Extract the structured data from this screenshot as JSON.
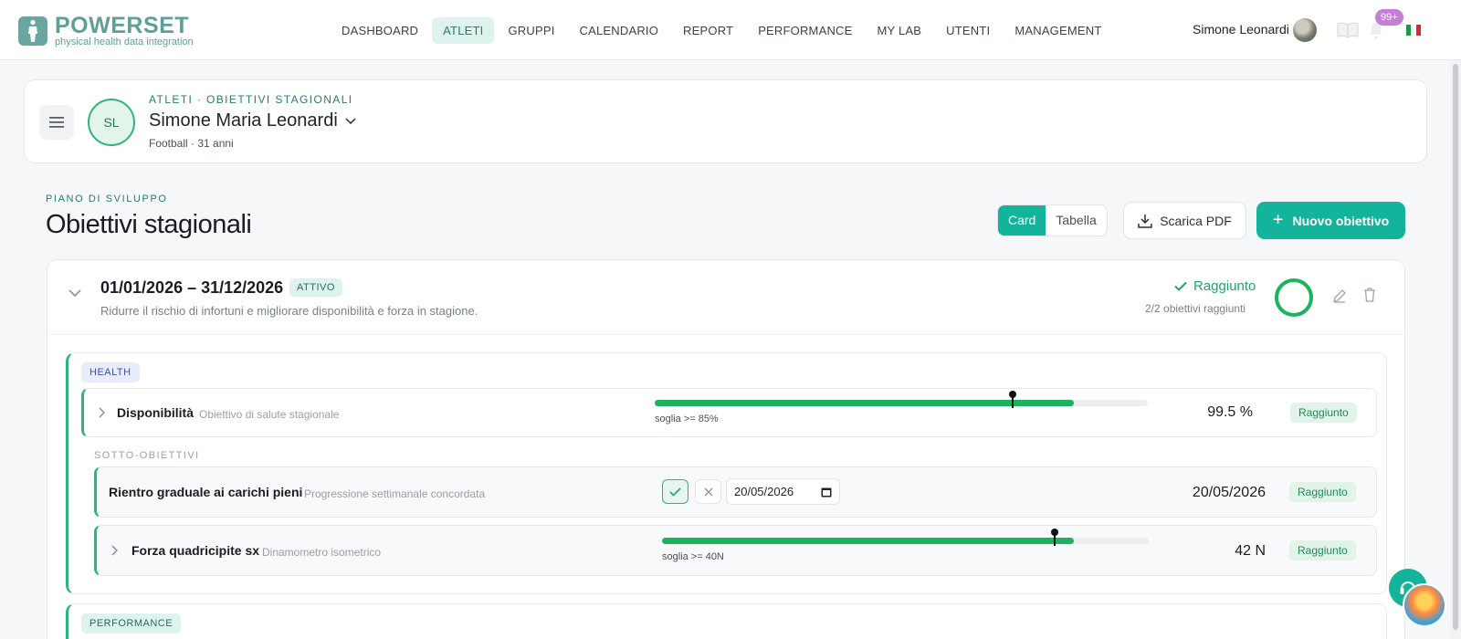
{
  "brand": {
    "name": "POWERSET",
    "tagline": "physical health data integration",
    "accent": "#14b39b"
  },
  "nav": {
    "items": [
      {
        "label": "DASHBOARD"
      },
      {
        "label": "ATLETI",
        "active": true
      },
      {
        "label": "GRUPPI"
      },
      {
        "label": "CALENDARIO"
      },
      {
        "label": "REPORT"
      },
      {
        "label": "PERFORMANCE"
      },
      {
        "label": "MY LAB"
      },
      {
        "label": "UTENTI"
      },
      {
        "label": "MANAGEMENT"
      }
    ],
    "user_name": "Simone Leonardi",
    "notifications_badge": "99+",
    "language_flag": "italy-flag-icon"
  },
  "athlete": {
    "breadcrumb": "ATLETI · OBIETTIVI STAGIONALI",
    "initials": "SL",
    "name": "Simone Maria Leonardi",
    "meta": "Football · 31 anni"
  },
  "section": {
    "kicker": "PIANO DI SVILUPPO",
    "title": "Obiettivi stagionali",
    "view_toggle": {
      "card": "Card",
      "table": "Tabella",
      "selected": "Card"
    },
    "download_pdf_label": "Scarica PDF",
    "new_goal_label": "Nuovo obiettivo"
  },
  "goal": {
    "dates": "01/01/2026 – 31/12/2026",
    "status_badge": "ATTIVO",
    "description": "Ridurre il rischio di infortuni e migliorare disponibilità e forza in stagione.",
    "result": "Raggiunto",
    "progress_text": "2/2 obiettivi raggiunti",
    "progress_fraction": 1.0,
    "categories": [
      {
        "tag": "HEALTH",
        "objective": {
          "title": "Disponibilità",
          "subtitle": "Obiettivo di salute stagionale",
          "threshold": "soglia >= 85%",
          "bar_fill_fraction": 0.85,
          "marker_fraction": 0.725,
          "value": "99.5 %",
          "status": "Raggiunto"
        },
        "subobjectives_label": "SOTTO-OBIETTIVI",
        "subobjectives": [
          {
            "title": "Rientro graduale ai carichi pieni",
            "subtitle": "Progressione settimanale concordata",
            "date_input_value": "20/05/2026",
            "value": "20/05/2026",
            "status": "Raggiunto"
          },
          {
            "title": "Forza quadricipite sx",
            "subtitle": "Dinamometro isometrico",
            "threshold": "soglia >= 40N",
            "bar_fill_fraction": 0.847,
            "marker_fraction": 0.806,
            "value": "42 N",
            "status": "Raggiunto"
          }
        ]
      },
      {
        "tag": "PERFORMANCE"
      }
    ]
  },
  "colors": {
    "success": "#1bb35f",
    "health_tag": "#3f4fb3",
    "performance_tag": "#1f6c62"
  }
}
